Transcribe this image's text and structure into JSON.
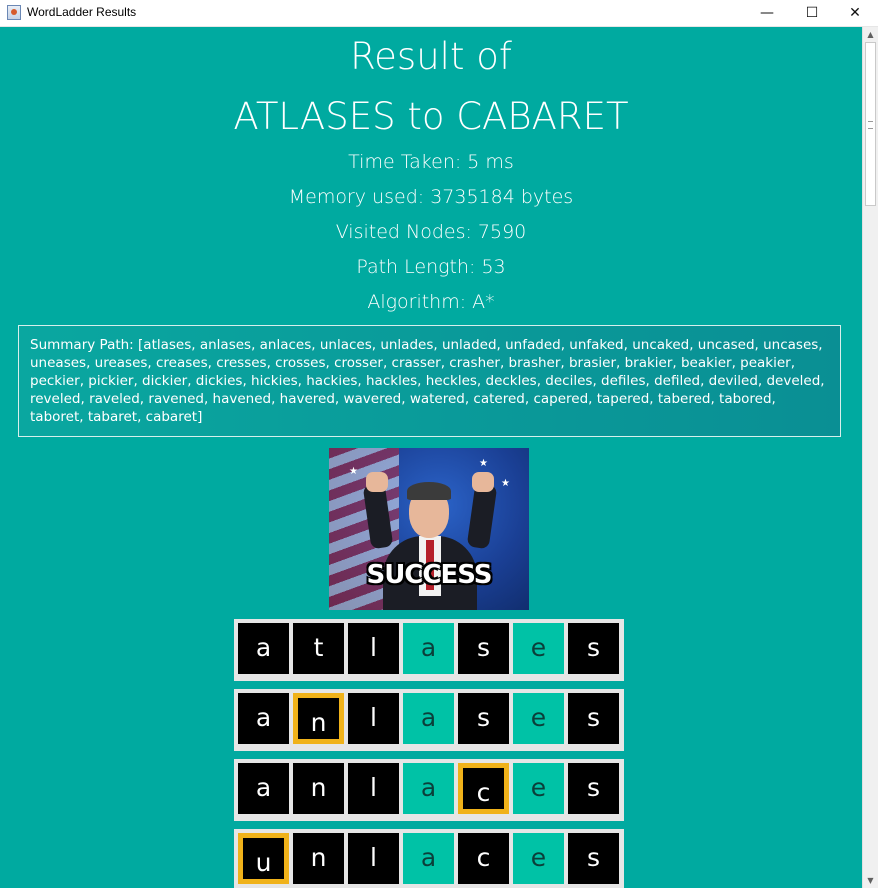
{
  "window": {
    "title": "WordLadder Results",
    "minimize_glyph": "—",
    "maximize_glyph": "☐",
    "close_glyph": "✕"
  },
  "result": {
    "title_line1": "Result of",
    "title_line2": "ATLASES to CABARET",
    "time_taken": "Time Taken: 5 ms",
    "memory_used": "Memory used: 3735184 bytes",
    "visited_nodes": "Visited Nodes: 7590",
    "path_length": "Path Length: 53",
    "algorithm": "Algorithm: A*",
    "summary_path": "Summary Path: [atlases, anlases, anlaces, unlaces, unlades, unladed, unfaded, unfaked, uncaked, uncased, uncases, uneases, ureases, creases, cresses, crosses, crosser, crasser, crasher, brasher, brasier, brakier, beakier, peakier, peckier, pickier, dickier, dickies, hickies, hackies, hackles, heckles, deckles, deciles, defiles, defiled, deviled, develed, reveled, raveled, ravened, havened, havered, wavered, watered, catered, capered, tapered, tabered, tabored, taboret, tabaret, cabaret]"
  },
  "image": {
    "caption": "SUCCESS",
    "icon": "success-celebration-image"
  },
  "ladder": {
    "rows": [
      {
        "word": "atlases",
        "letters": [
          {
            "ch": "a",
            "style": "black"
          },
          {
            "ch": "t",
            "style": "black"
          },
          {
            "ch": "l",
            "style": "black"
          },
          {
            "ch": "a",
            "style": "green"
          },
          {
            "ch": "s",
            "style": "black"
          },
          {
            "ch": "e",
            "style": "green"
          },
          {
            "ch": "s",
            "style": "black"
          }
        ]
      },
      {
        "word": "anlases",
        "letters": [
          {
            "ch": "a",
            "style": "black"
          },
          {
            "ch": "n",
            "style": "changed"
          },
          {
            "ch": "l",
            "style": "black"
          },
          {
            "ch": "a",
            "style": "green"
          },
          {
            "ch": "s",
            "style": "black"
          },
          {
            "ch": "e",
            "style": "green"
          },
          {
            "ch": "s",
            "style": "black"
          }
        ]
      },
      {
        "word": "anlaces",
        "letters": [
          {
            "ch": "a",
            "style": "black"
          },
          {
            "ch": "n",
            "style": "black"
          },
          {
            "ch": "l",
            "style": "black"
          },
          {
            "ch": "a",
            "style": "green"
          },
          {
            "ch": "c",
            "style": "changed"
          },
          {
            "ch": "e",
            "style": "green"
          },
          {
            "ch": "s",
            "style": "black"
          }
        ]
      },
      {
        "word": "unlaces",
        "letters": [
          {
            "ch": "u",
            "style": "changed"
          },
          {
            "ch": "n",
            "style": "black"
          },
          {
            "ch": "l",
            "style": "black"
          },
          {
            "ch": "a",
            "style": "green"
          },
          {
            "ch": "c",
            "style": "black"
          },
          {
            "ch": "e",
            "style": "green"
          },
          {
            "ch": "s",
            "style": "black"
          }
        ]
      }
    ]
  },
  "colors": {
    "background": "#00aaa0",
    "tile_black": "#000000",
    "tile_green": "#00c2a6",
    "changed_border": "#f0b21a",
    "row_frame": "#e6e6e6"
  },
  "scrollbar": {
    "up_glyph": "▲",
    "down_glyph": "▼"
  }
}
